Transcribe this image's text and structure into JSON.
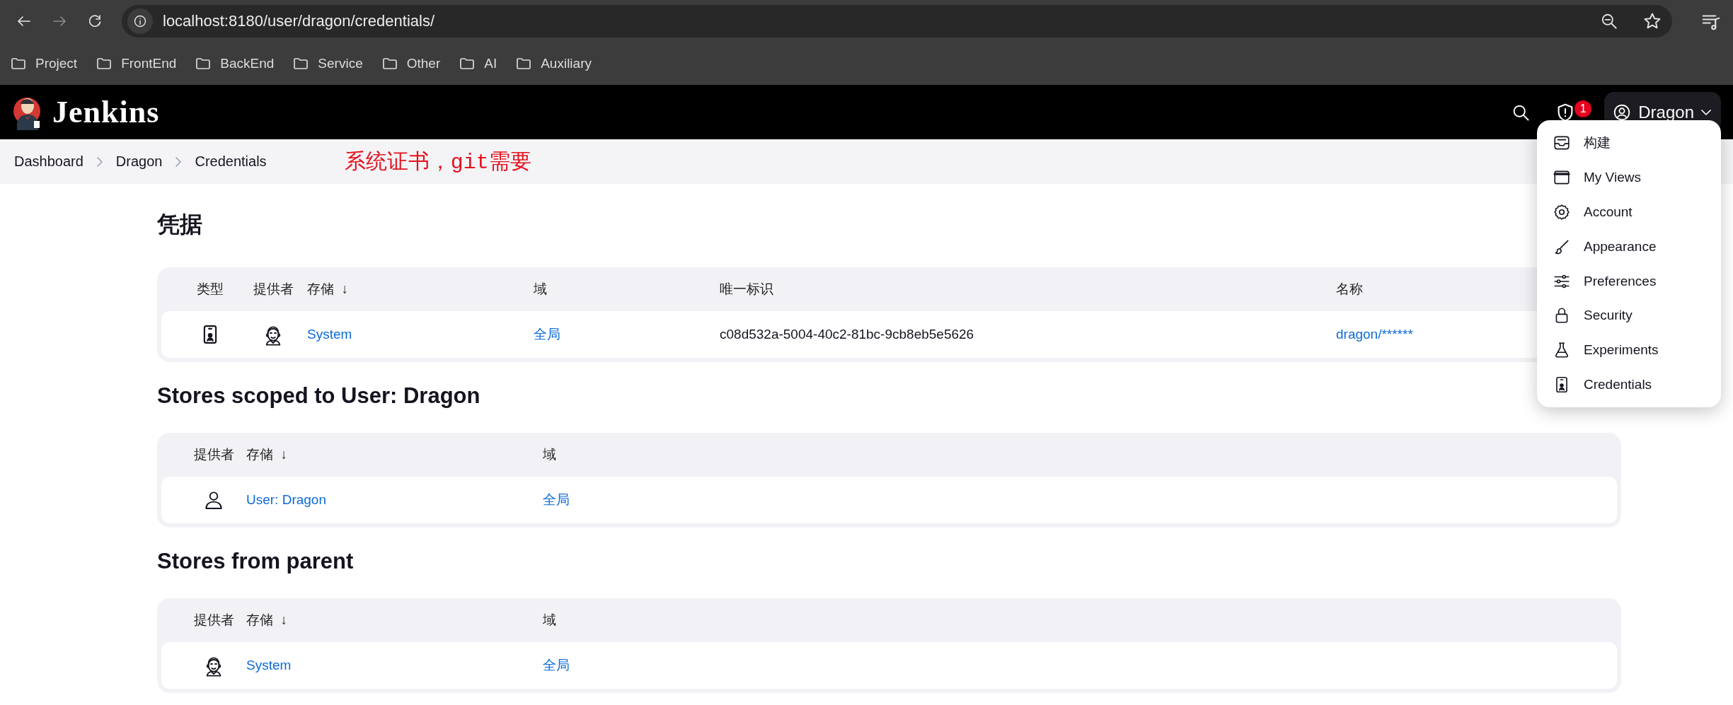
{
  "browser": {
    "address": "localhost:8180/user/dragon/credentials/",
    "bookmarks": [
      "Project",
      "FrontEnd",
      "BackEnd",
      "Service",
      "Other",
      "AI",
      "Auxiliary"
    ]
  },
  "header": {
    "brand": "Jenkins",
    "alert_count": "1",
    "user": "Dragon"
  },
  "breadcrumbs": [
    "Dashboard",
    "Dragon",
    "Credentials"
  ],
  "annotation": "系统证书，git需要",
  "user_menu": [
    "构建",
    "My Views",
    "Account",
    "Appearance",
    "Preferences",
    "Security",
    "Experiments",
    "Credentials"
  ],
  "credentials": {
    "title": "凭据",
    "columns": [
      {
        "label": "类型"
      },
      {
        "label": "提供者"
      },
      {
        "label": "存储",
        "sort": "↓"
      },
      {
        "label": "域"
      },
      {
        "label": "唯一标识"
      },
      {
        "label": "名称"
      }
    ],
    "rows": [
      {
        "kind": "system",
        "store": "System",
        "domain": "全局",
        "id": "c08d532a-5004-40c2-81bc-9cb8eb5e5626",
        "name": "dragon/******"
      }
    ]
  },
  "user_stores": {
    "title": "Stores scoped to User: Dragon",
    "columns": [
      {
        "label": "提供者"
      },
      {
        "label": "存储",
        "sort": "↓"
      },
      {
        "label": "域"
      }
    ],
    "rows": [
      {
        "kind": "user",
        "store": "User: Dragon",
        "domain": "全局"
      }
    ]
  },
  "parent_stores": {
    "title": "Stores from parent",
    "columns": [
      {
        "label": "提供者"
      },
      {
        "label": "存储",
        "sort": "↓"
      },
      {
        "label": "域"
      }
    ],
    "rows": [
      {
        "kind": "system",
        "store": "System",
        "domain": "全局"
      }
    ]
  }
}
